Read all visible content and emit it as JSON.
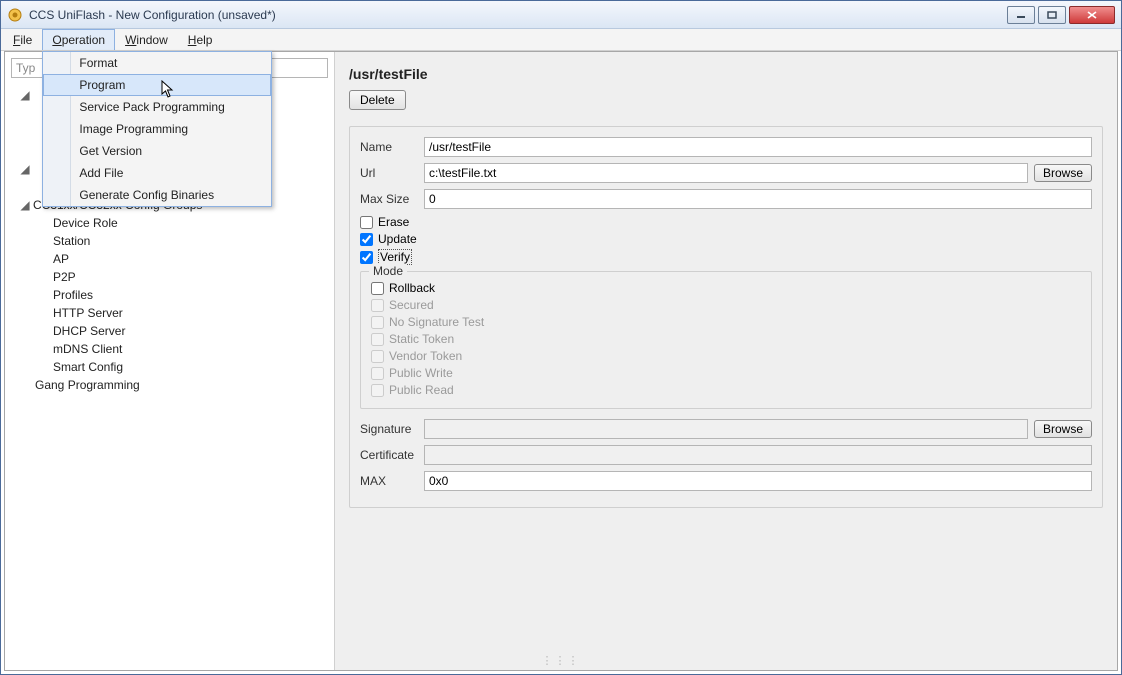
{
  "title": "CCS UniFlash - New Configuration (unsaved*)",
  "window_controls": {
    "min": "min",
    "max": "max",
    "close": "close"
  },
  "menubar": {
    "file": "File",
    "operation": "Operation",
    "window": "Window",
    "help": "Help"
  },
  "operation_menu": {
    "format": "Format",
    "program": "Program",
    "service_pack": "Service Pack Programming",
    "image_programming": "Image Programming",
    "get_version": "Get Version",
    "add_file": "Add File",
    "generate_config": "Generate Config Binaries"
  },
  "filter_placeholder": "Typ",
  "tree": {
    "usr_testfile": "/usr/testFile",
    "config_groups": "CC31xx/CC32xx Config Groups",
    "device_role": "Device Role",
    "station": "Station",
    "ap": "AP",
    "p2p": "P2P",
    "profiles": "Profiles",
    "http_server": "HTTP Server",
    "dhcp_server": "DHCP Server",
    "mdns_client": "mDNS Client",
    "smart_config": "Smart Config",
    "gang_programming": "Gang Programming"
  },
  "page": {
    "title": "/usr/testFile",
    "delete_btn": "Delete",
    "name_label": "Name",
    "name_value": "/usr/testFile",
    "url_label": "Url",
    "url_value": "c:\\testFile.txt",
    "browse_btn": "Browse",
    "maxsize_label": "Max Size",
    "maxsize_value": "0",
    "erase_label": "Erase",
    "update_label": "Update",
    "verify_label": "Verify",
    "mode_legend": "Mode",
    "rollback": "Rollback",
    "secured": "Secured",
    "no_sig": "No Signature Test",
    "static_token": "Static Token",
    "vendor_token": "Vendor Token",
    "public_write": "Public Write",
    "public_read": "Public Read",
    "signature_label": "Signature",
    "certificate_label": "Certificate",
    "max_hex_label": "MAX",
    "max_hex_value": "0x0"
  }
}
